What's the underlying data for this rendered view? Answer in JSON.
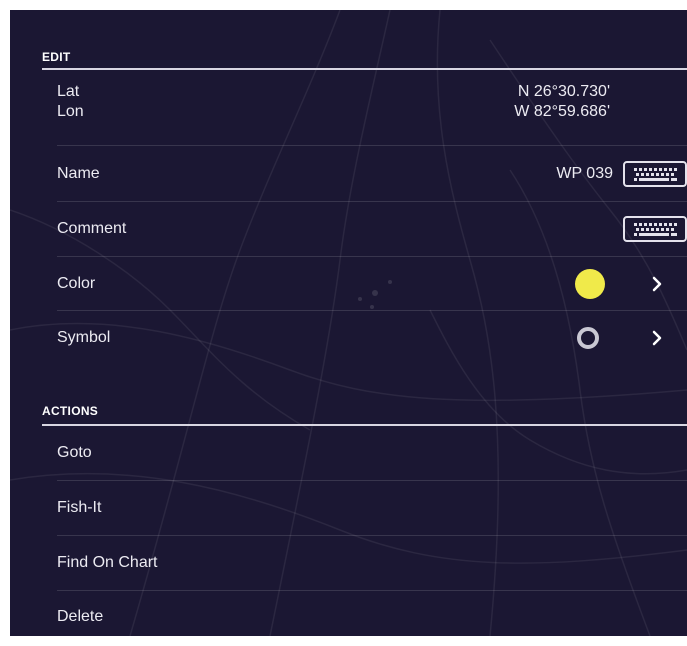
{
  "edit_section": {
    "title": "EDIT",
    "lat_label": "Lat",
    "lon_label": "Lon",
    "lat_value": "N 26°30.730'",
    "lon_value": "W 82°59.686'",
    "name_label": "Name",
    "name_value": "WP 039",
    "comment_label": "Comment",
    "color_label": "Color",
    "color_value": "#f0ea4a",
    "symbol_label": "Symbol"
  },
  "actions_section": {
    "title": "ACTIONS",
    "items": [
      {
        "label": "Goto"
      },
      {
        "label": "Fish-It"
      },
      {
        "label": "Find On Chart"
      },
      {
        "label": "Delete"
      }
    ]
  },
  "icons": {
    "keyboard": "keyboard-icon",
    "chevron": "chevron-right-icon",
    "symbol": "circle-symbol-icon"
  },
  "theme": {
    "background": "#1b1733",
    "text": "#ecebf2",
    "accent_yellow": "#f0ea4a"
  }
}
